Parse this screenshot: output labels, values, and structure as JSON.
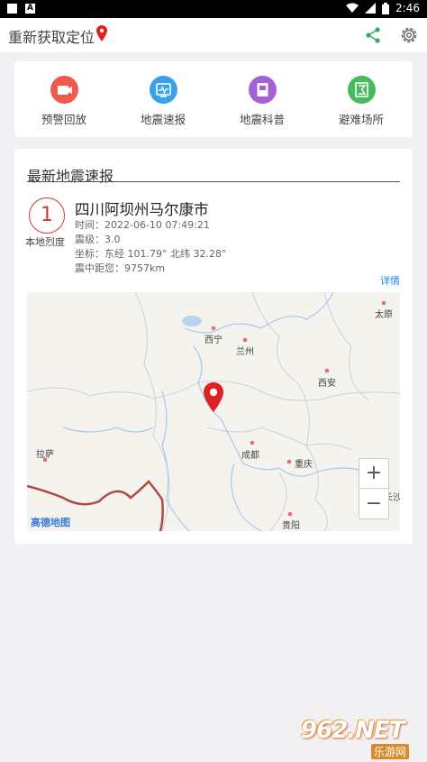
{
  "status_bar": {
    "time": "2:46"
  },
  "app_bar": {
    "title": "重新获取定位",
    "pin_icon": "location-pin-icon",
    "share_icon": "share-icon",
    "settings_icon": "gear-icon"
  },
  "menu": [
    {
      "label": "预警回放",
      "icon": "playback-icon",
      "color": "#ef5a4c"
    },
    {
      "label": "地震速报",
      "icon": "report-icon",
      "color": "#3aa0e8"
    },
    {
      "label": "地震科普",
      "icon": "book-icon",
      "color": "#a65fd4"
    },
    {
      "label": "避难场所",
      "icon": "shelter-icon",
      "color": "#46bb5e"
    }
  ],
  "quake": {
    "section_title": "最新地震速报",
    "intensity": "1",
    "intensity_label": "本地烈度",
    "place": "四川阿坝州马尔康市",
    "time_line": "时间：2022-06-10 07:49:21",
    "magnitude_line": "震级：3.0",
    "coords_line": "坐标：东经 101.79° 北纬 32.28°",
    "distance_line": "震中距您：9757km",
    "details_label": "详情"
  },
  "map": {
    "cities": [
      {
        "name": "太原",
        "key": "taiyuan"
      },
      {
        "name": "西宁",
        "key": "xining"
      },
      {
        "name": "兰州",
        "key": "lanzhou"
      },
      {
        "name": "西安",
        "key": "xian"
      },
      {
        "name": "拉萨",
        "key": "lasa"
      },
      {
        "name": "成都",
        "key": "chengdu"
      },
      {
        "name": "重庆",
        "key": "chongqing"
      },
      {
        "name": "长沙",
        "key": "changsha"
      },
      {
        "name": "贵阳",
        "key": "guiyang"
      }
    ],
    "zoom_in": "+",
    "zoom_out": "−",
    "logo": "高德地图",
    "marker_color": "#e02020"
  },
  "watermark": {
    "main": "962.NET",
    "sub": "乐游网"
  }
}
